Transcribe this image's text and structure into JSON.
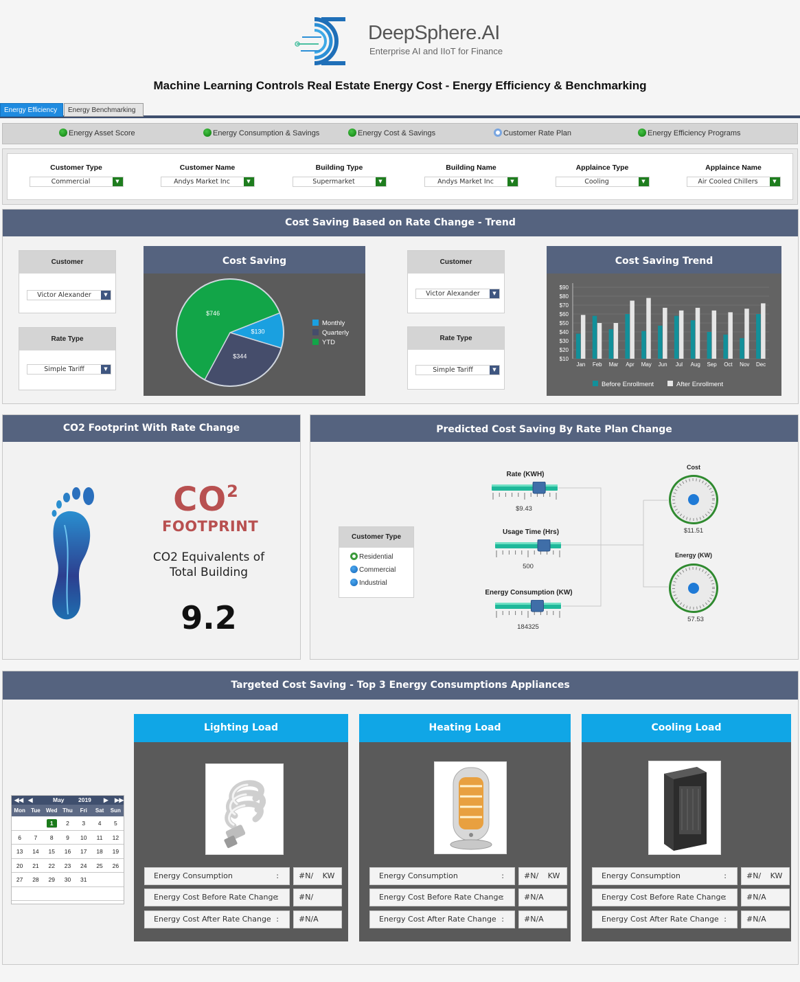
{
  "brand": {
    "name": "DeepSphere.AI",
    "tagline": "Enterprise AI and IIoT for Finance"
  },
  "title": "Machine Learning Controls Real Estate Energy Cost - Energy Efficiency & Benchmarking",
  "tabs": [
    {
      "label": "Energy Efficiency",
      "active": true
    },
    {
      "label": "Energy Benchmarking",
      "active": false
    }
  ],
  "radio_options": [
    {
      "label": "Energy Asset Score",
      "selected": false
    },
    {
      "label": "Energy Consumption & Savings",
      "selected": false
    },
    {
      "label": "Energy Cost & Savings",
      "selected": false
    },
    {
      "label": "Customer Rate Plan",
      "selected": true
    },
    {
      "label": "Energy Efficiency Programs",
      "selected": false
    }
  ],
  "filters": [
    {
      "label": "Customer Type",
      "value": "Commercial"
    },
    {
      "label": "Customer  Name",
      "value": "Andys Market Inc"
    },
    {
      "label": "Building Type",
      "value": "Supermarket"
    },
    {
      "label": "Building Name",
      "value": "Andys Market Inc"
    },
    {
      "label": "Applaince Type",
      "value": "Cooling"
    },
    {
      "label": "Applaince Name",
      "value": "Air Cooled Chillers"
    }
  ],
  "trend_section": {
    "title": "Cost Saving Based on Rate Change - Trend",
    "left_controls": {
      "customer_label": "Customer",
      "customer_value": "Victor Alexander",
      "rate_label": "Rate Type",
      "rate_value": "Simple Tariff"
    },
    "right_controls": {
      "customer_label": "Customer",
      "customer_value": "Victor Alexander",
      "rate_label": "Rate Type",
      "rate_value": "Simple Tariff"
    }
  },
  "chart_data": [
    {
      "type": "pie",
      "title": "Cost Saving",
      "labels": [
        "Monthly",
        "Quarterly",
        "YTD"
      ],
      "values": [
        130,
        344,
        746
      ],
      "value_labels": [
        "$130",
        "$344",
        "$746"
      ],
      "colors": [
        "#1aa0e0",
        "#454d6b",
        "#12a548"
      ],
      "legend": "right"
    },
    {
      "type": "bar",
      "title": "Cost Saving Trend",
      "categories": [
        "Jan",
        "Feb",
        "Mar",
        "Apr",
        "May",
        "Jun",
        "Jul",
        "Aug",
        "Sep",
        "Oct",
        "Nov",
        "Dec"
      ],
      "series": [
        {
          "name": "Before Enrollment",
          "values": [
            38,
            58,
            43,
            60,
            41,
            47,
            58,
            53,
            40,
            37,
            33,
            60
          ],
          "color": "#12909a"
        },
        {
          "name": "After Enrollment",
          "values": [
            59,
            50,
            50,
            75,
            78,
            67,
            64,
            67,
            64,
            62,
            66,
            72
          ],
          "color": "#e6e6e6"
        }
      ],
      "ylim": [
        10,
        90
      ],
      "yticks": [
        "$10",
        "$20",
        "$30",
        "$40",
        "$50",
        "$60",
        "$70",
        "$80",
        "$90"
      ],
      "legend": "bottom",
      "grid": true
    }
  ],
  "co2": {
    "title": "CO2 Footprint With Rate Change",
    "logo_big": "CO",
    "logo_sup": "2",
    "logo_word": "FOOTPRINT",
    "caption_line1": "CO2 Equivalents of",
    "caption_line2": "Total Building",
    "value": "9.2"
  },
  "predicted": {
    "title": "Predicted Cost Saving By Rate Plan Change",
    "customer_type": {
      "label": "Customer Type",
      "options": [
        {
          "label": "Residential",
          "selected": true
        },
        {
          "label": "Commercial",
          "selected": false
        },
        {
          "label": "Industrial",
          "selected": false
        }
      ]
    },
    "sliders": [
      {
        "label": "Rate (KWH)",
        "value": "$9.43",
        "fraction": 0.72
      },
      {
        "label": "Usage Time (Hrs)",
        "value": "500",
        "fraction": 0.74
      },
      {
        "label": "Energy Consumption (KW)",
        "value": "184325",
        "fraction": 0.64
      }
    ],
    "gauges": [
      {
        "label": "Cost",
        "value": "$11.51"
      },
      {
        "label": "Energy (KW)",
        "value": "57.53"
      }
    ]
  },
  "targeted": {
    "title": "Targeted Cost Saving  -  Top 3 Energy Consumptions Appliances",
    "calendar": {
      "month": "May",
      "year": "2019",
      "nav": {
        "first": "◀◀",
        "prev": "◀",
        "next": "▶",
        "last": "▶▶"
      },
      "weekdays": [
        "Mon",
        "Tue",
        "Wed",
        "Thu",
        "Fri",
        "Sat",
        "Sun"
      ],
      "today": "1"
    },
    "loads": [
      {
        "title": "Lighting Load",
        "rows": [
          {
            "label": "Energy Consumption",
            "sep": ":",
            "value": "#N/ KW"
          },
          {
            "label": "Energy Cost Before Rate Change",
            "sep": ":",
            "value": "#N/"
          },
          {
            "label": "Energy Cost After Rate Change",
            "sep": ":",
            "value": "#N/A"
          }
        ]
      },
      {
        "title": "Heating Load",
        "rows": [
          {
            "label": "Energy Consumption",
            "sep": ":",
            "value": "#N/ KW"
          },
          {
            "label": "Energy Cost Before Rate Change",
            "sep": ":",
            "value": "#N/A"
          },
          {
            "label": "Energy Cost After Rate Change",
            "sep": ":",
            "value": "#N/A"
          }
        ]
      },
      {
        "title": "Cooling Load",
        "rows": [
          {
            "label": "Energy Consumption",
            "sep": ":",
            "value": "#N/ KW"
          },
          {
            "label": "Energy Cost Before Rate Change",
            "sep": ":",
            "value": "#N/A"
          },
          {
            "label": "Energy Cost After Rate Change",
            "sep": ":",
            "value": "#N/A"
          }
        ]
      }
    ]
  }
}
